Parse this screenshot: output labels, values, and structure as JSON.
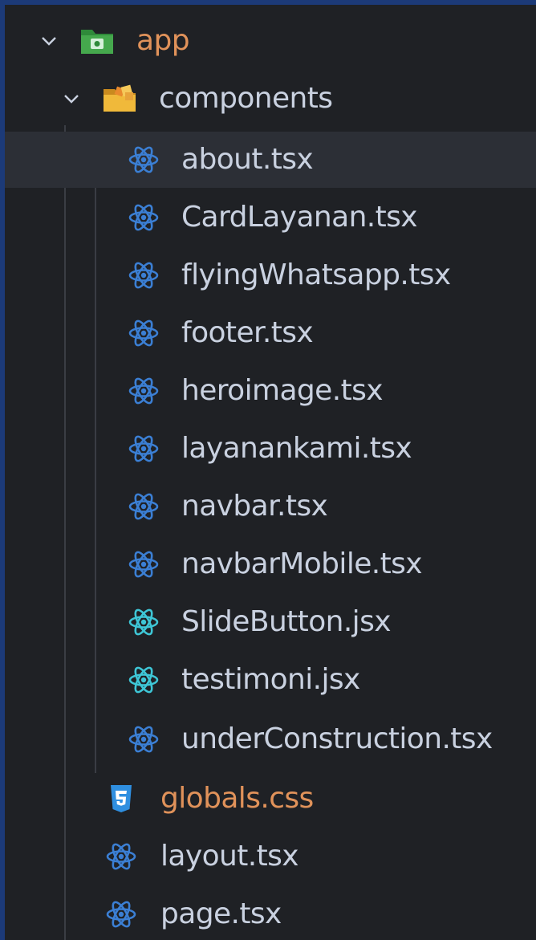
{
  "explorer": {
    "root": {
      "label": "app",
      "expanded": true,
      "icon": "folder-app-green-icon"
    },
    "components": {
      "label": "components",
      "expanded": true,
      "icon": "folder-components-yellow-icon"
    },
    "component_files": [
      {
        "label": "about.tsx",
        "icon": "react-icon",
        "selected": true
      },
      {
        "label": "CardLayanan.tsx",
        "icon": "react-icon"
      },
      {
        "label": "flyingWhatsapp.tsx",
        "icon": "react-icon"
      },
      {
        "label": "footer.tsx",
        "icon": "react-icon"
      },
      {
        "label": "heroimage.tsx",
        "icon": "react-icon"
      },
      {
        "label": "layanankami.tsx",
        "icon": "react-icon"
      },
      {
        "label": "navbar.tsx",
        "icon": "react-icon"
      },
      {
        "label": "navbarMobile.tsx",
        "icon": "react-icon"
      },
      {
        "label": "SlideButton.jsx",
        "icon": "react-jsx-icon"
      },
      {
        "label": "testimoni.jsx",
        "icon": "react-jsx-icon"
      },
      {
        "label": "underConstruction.tsx",
        "icon": "react-icon"
      }
    ],
    "app_files": [
      {
        "label": "globals.css",
        "icon": "css3-icon"
      },
      {
        "label": "layout.tsx",
        "icon": "react-icon"
      },
      {
        "label": "page.tsx",
        "icon": "react-icon"
      }
    ]
  },
  "colors": {
    "background": "#1f2125",
    "selected_row": "#2c2f36",
    "tsx_icon": "#3b7fd4",
    "jsx_icon": "#3ec6d6",
    "css_icon": "#2f8fe0",
    "folder_label": "#e0925a",
    "file_label": "#c9d1e0"
  }
}
